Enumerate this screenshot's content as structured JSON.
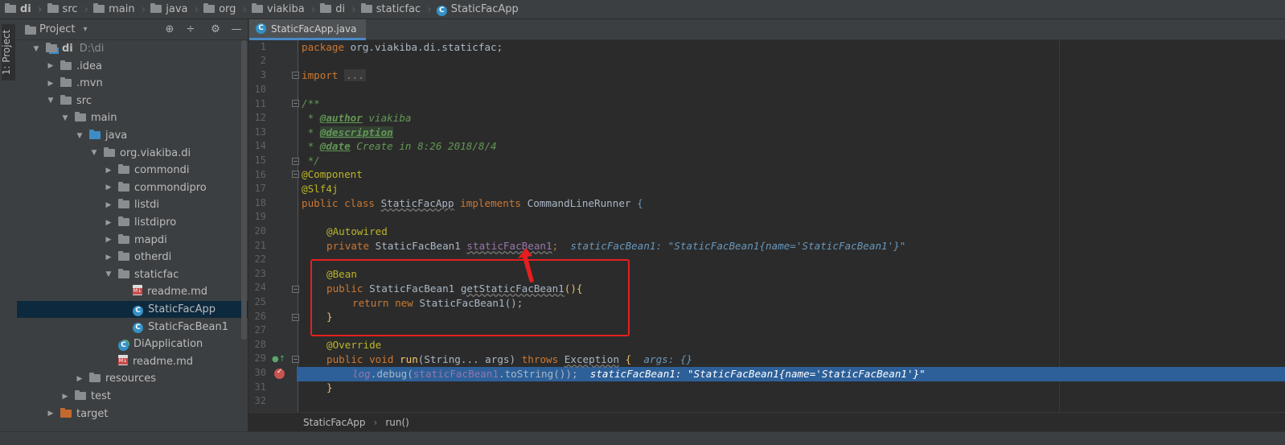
{
  "breadcrumb": [
    "di",
    "src",
    "main",
    "java",
    "org",
    "viakiba",
    "di",
    "staticfac",
    "StaticFacApp"
  ],
  "tool_stripe": {
    "project_label": "1: Project"
  },
  "project_panel": {
    "title": "Project",
    "view_dropdown": "▾",
    "tools": {
      "locate": "⊕",
      "collapse": "÷",
      "settings": "⚙",
      "hide": "—"
    }
  },
  "tree": [
    {
      "label": "di",
      "path_hint": "D:\\di",
      "depth": 0,
      "arrow": "▼",
      "icon": "module-folder-icon",
      "bold": true
    },
    {
      "label": ".idea",
      "depth": 1,
      "arrow": "▶",
      "icon": "folder-icon"
    },
    {
      "label": ".mvn",
      "depth": 1,
      "arrow": "▶",
      "icon": "folder-icon"
    },
    {
      "label": "src",
      "depth": 1,
      "arrow": "▼",
      "icon": "folder-icon"
    },
    {
      "label": "main",
      "depth": 2,
      "arrow": "▼",
      "icon": "folder-icon"
    },
    {
      "label": "java",
      "depth": 3,
      "arrow": "▼",
      "icon": "source-folder-icon"
    },
    {
      "label": "org.viakiba.di",
      "depth": 4,
      "arrow": "▼",
      "icon": "package-icon"
    },
    {
      "label": "commondi",
      "depth": 5,
      "arrow": "▶",
      "icon": "package-icon"
    },
    {
      "label": "commondipro",
      "depth": 5,
      "arrow": "▶",
      "icon": "package-icon"
    },
    {
      "label": "listdi",
      "depth": 5,
      "arrow": "▶",
      "icon": "package-icon"
    },
    {
      "label": "listdipro",
      "depth": 5,
      "arrow": "▶",
      "icon": "package-icon"
    },
    {
      "label": "mapdi",
      "depth": 5,
      "arrow": "▶",
      "icon": "package-icon"
    },
    {
      "label": "otherdi",
      "depth": 5,
      "arrow": "▶",
      "icon": "package-icon"
    },
    {
      "label": "staticfac",
      "depth": 5,
      "arrow": "▼",
      "icon": "package-icon"
    },
    {
      "label": "readme.md",
      "depth": 6,
      "arrow": "",
      "icon": "markdown-file-icon"
    },
    {
      "label": "StaticFacApp",
      "depth": 6,
      "arrow": "",
      "icon": "class-icon",
      "selected": true
    },
    {
      "label": "StaticFacBean1",
      "depth": 6,
      "arrow": "",
      "icon": "class-icon"
    },
    {
      "label": "DiApplication",
      "depth": 5,
      "arrow": "",
      "icon": "spring-class-icon"
    },
    {
      "label": "readme.md",
      "depth": 5,
      "arrow": "",
      "icon": "markdown-file-icon"
    },
    {
      "label": "resources",
      "depth": 3,
      "arrow": "▶",
      "icon": "resources-folder-icon"
    },
    {
      "label": "test",
      "depth": 2,
      "arrow": "▶",
      "icon": "folder-icon"
    },
    {
      "label": "target",
      "depth": 1,
      "arrow": "▶",
      "icon": "excluded-folder-icon"
    }
  ],
  "tab": {
    "label": "StaticFacApp.java"
  },
  "line_numbers": [
    "1",
    "2",
    "3",
    "10",
    "11",
    "12",
    "13",
    "14",
    "15",
    "16",
    "17",
    "18",
    "19",
    "20",
    "21",
    "22",
    "23",
    "24",
    "25",
    "26",
    "27",
    "28",
    "29",
    "30",
    "31",
    "32"
  ],
  "code": {
    "l1": {
      "kw": "package",
      "rest": " org.viakiba.di.staticfac;"
    },
    "l3": {
      "kw": "import",
      "folded": "..."
    },
    "l11": "/**",
    "l12": {
      "star": " * ",
      "tag": "@author",
      "text": " viakiba"
    },
    "l13": {
      "star": " * ",
      "tag": "@description"
    },
    "l14": {
      "star": " * ",
      "tag": "@date",
      "text": " Create in 8:26 2018/8/4"
    },
    "l15": " */",
    "l16": "@Component",
    "l17": "@Slf4j",
    "l18": {
      "kw1": "public class",
      "name": "StaticFacApp",
      "kw2": "implements",
      "iface": "CommandLineRunner",
      "brace": "{"
    },
    "l20": "@Autowired",
    "l21": {
      "kw": "private",
      "type": "StaticFacBean1",
      "field": "staticFacBean1",
      "semi": ";",
      "hint": "staticFacBean1: \"StaticFacBean1{name='StaticFacBean1'}\""
    },
    "l23": "@Bean",
    "l24": {
      "kw": "public",
      "type": "StaticFacBean1",
      "method": "getStaticFacBean1",
      "tail": "(){"
    },
    "l25": {
      "kw1": "return",
      "kw2": "new",
      "tail": "StaticFacBean1();"
    },
    "l26": "}",
    "l28": "@Override",
    "l29": {
      "kw1": "public",
      "kw2": "void",
      "method": "run",
      "params": "(String... args)",
      "kw3": "throws",
      "exc": "Exception",
      "brace": "{",
      "hint": "args: {}"
    },
    "l30": {
      "log": "log",
      "call": ".debug(",
      "field": "staticFacBean1",
      "tail": ".toString());",
      "hint": "staticFacBean1: \"StaticFacBean1{name='StaticFacBean1'}\""
    },
    "l31": "}"
  },
  "editor_breadcrumb": {
    "cls": "StaticFacApp",
    "sep": "›",
    "method": "run()"
  },
  "colors": {
    "annotation_box": "#e51f1f",
    "execution_line": "#2d6099",
    "keyword": "#cc7832",
    "annotation": "#bbb529"
  }
}
